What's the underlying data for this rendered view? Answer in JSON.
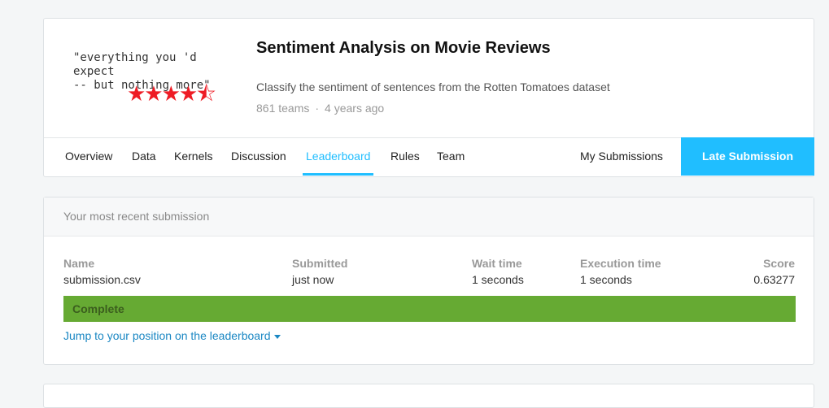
{
  "competition": {
    "thumbnail_quote": "\"everything you 'd expect\n-- but nothing more\"",
    "thumbnail_stars": "★★★★⯪",
    "title": "Sentiment Analysis on Movie Reviews",
    "description": "Classify the sentiment of sentences from the Rotten Tomatoes dataset",
    "teams": "861 teams",
    "meta_separator": "·",
    "age": "4 years ago"
  },
  "nav": {
    "tabs": [
      {
        "label": "Overview"
      },
      {
        "label": "Data"
      },
      {
        "label": "Kernels"
      },
      {
        "label": "Discussion"
      },
      {
        "label": "Leaderboard",
        "active": true
      },
      {
        "label": "Rules"
      },
      {
        "label": "Team"
      }
    ],
    "my_submissions": "My Submissions",
    "late_submission": "Late Submission"
  },
  "submission": {
    "header": "Your most recent submission",
    "columns": {
      "name": {
        "label": "Name",
        "value": "submission.csv"
      },
      "submitted": {
        "label": "Submitted",
        "value": "just now"
      },
      "wait_time": {
        "label": "Wait time",
        "value": "1 seconds"
      },
      "execution_time": {
        "label": "Execution time",
        "value": "1 seconds"
      },
      "score": {
        "label": "Score",
        "value": "0.63277"
      }
    },
    "status": "Complete",
    "status_color": "#66aa33",
    "jump_link": "Jump to your position on the leaderboard"
  },
  "colors": {
    "accent": "#20beff",
    "link": "#1a87c3",
    "star": "#ee1c25"
  }
}
